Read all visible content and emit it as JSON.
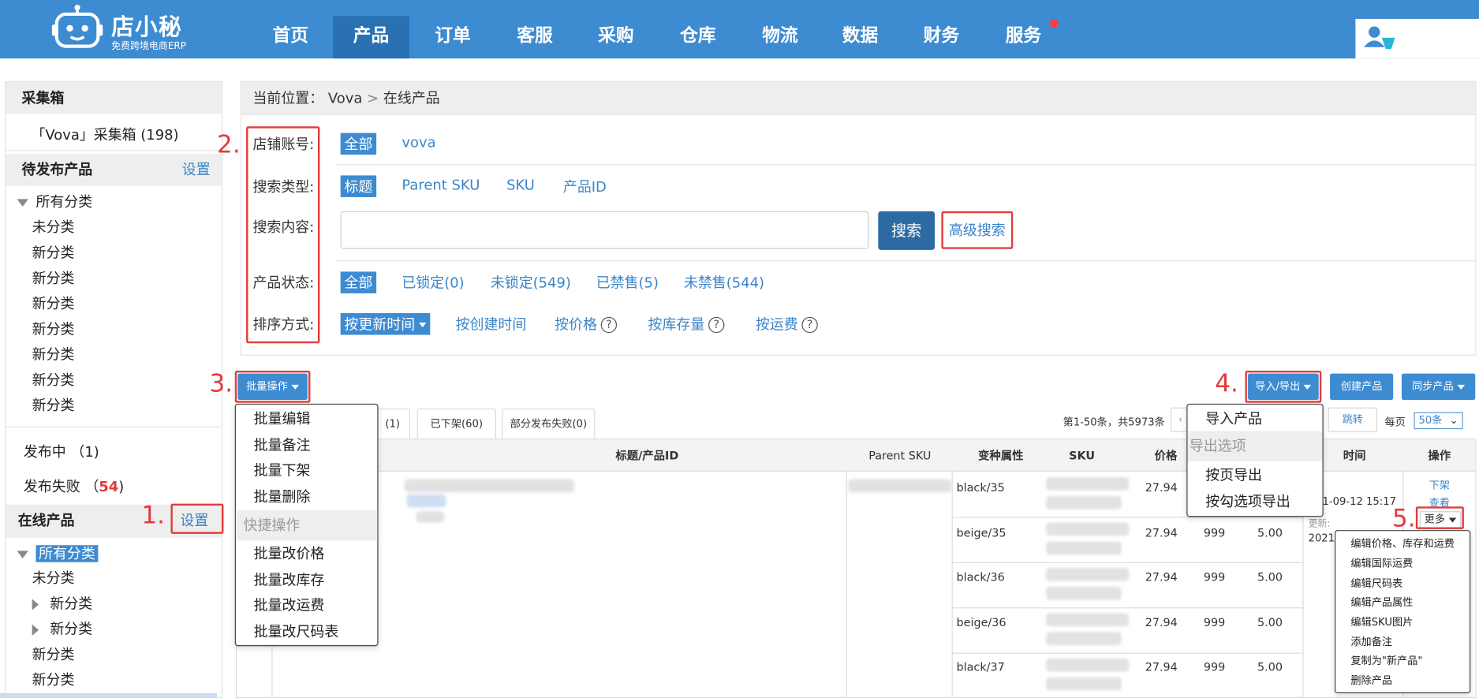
{
  "header": {
    "brand_name": "店小秘",
    "brand_tagline": "免费跨境电商ERP",
    "nav": [
      "首页",
      "产品",
      "订单",
      "客服",
      "采购",
      "仓库",
      "物流",
      "数据",
      "财务",
      "服务"
    ],
    "active_nav": "产品"
  },
  "sidebar": {
    "collect_box": {
      "title": "采集箱",
      "item": "「Vova」采集箱 (198)"
    },
    "pending": {
      "title": "待发布产品",
      "setting": "设置",
      "all": "所有分类",
      "items": [
        "未分类",
        "新分类",
        "新分类",
        "新分类",
        "新分类",
        "新分类",
        "新分类",
        "新分类"
      ]
    },
    "publishing": "发布中 （1)",
    "failed_label": "发布失败 （",
    "failed_count": "54",
    "failed_suffix": ")",
    "online": {
      "title": "在线产品",
      "setting": "设置",
      "all": "所有分类",
      "items": [
        "未分类",
        "新分类",
        "新分类",
        "新分类",
        "新分类"
      ]
    }
  },
  "breadcrumb": {
    "label": "当前位置：",
    "shop": "Vova",
    "sep": ">",
    "page": "在线产品"
  },
  "filters": {
    "shop_label": "店铺账号:",
    "shop_all": "全部",
    "shop_vova": "vova",
    "type_label": "搜索类型:",
    "types": [
      "标题",
      "Parent SKU",
      "SKU",
      "产品ID"
    ],
    "content_label": "搜索内容:",
    "search_btn": "搜索",
    "advanced": "高级搜索",
    "status_label": "产品状态:",
    "statuses": [
      "全部",
      "已锁定(0)",
      "未锁定(549)",
      "已禁售(5)",
      "未禁售(544)"
    ],
    "sort_label": "排序方式:",
    "sort_active": "按更新时间",
    "sorts": [
      "按创建时间",
      "按价格",
      "按库存量",
      "按运费"
    ],
    "help_glyph": "?"
  },
  "annotations": [
    "1.",
    "2.",
    "3.",
    "4.",
    "5."
  ],
  "toolbar": {
    "batch": "批量操作",
    "import_export": "导入/导出",
    "create": "创建产品",
    "sync": "同步产品"
  },
  "tabs": [
    "(1)",
    "已下架(60)",
    "部分发布失败(0)"
  ],
  "pagination": {
    "summary": "第1-50条，共5973条",
    "jump": "跳转",
    "per_page": "每页",
    "per_page_value": "50条"
  },
  "table": {
    "headers": [
      "标题/产品ID",
      "Parent SKU",
      "变种属性",
      "SKU",
      "价格",
      "时间",
      "操作"
    ],
    "rows": [
      {
        "variant": "black/35",
        "price": "27.94"
      },
      {
        "variant": "beige/35",
        "price": "27.94",
        "stock": "999",
        "shipping": "5.00"
      },
      {
        "variant": "black/36",
        "price": "27.94",
        "stock": "999",
        "shipping": "5.00"
      },
      {
        "variant": "beige/36",
        "price": "27.94",
        "stock": "999",
        "shipping": "5.00"
      },
      {
        "variant": "black/37",
        "price": "27.94",
        "stock": "999",
        "shipping": "5.00"
      }
    ],
    "time1_label": "建:",
    "time1_value": "1-09-12 15:17",
    "time2_label": "更新:",
    "time2_value": "2021-",
    "action_offshelf": "下架",
    "action_view": "查看",
    "action_more": "更多"
  },
  "batch_menu": {
    "items": [
      "批量编辑",
      "批量备注",
      "批量下架",
      "批量删除"
    ],
    "section": "快捷操作",
    "quick": [
      "批量改价格",
      "批量改库存",
      "批量改运费",
      "批量改尺码表"
    ]
  },
  "import_menu": {
    "import": "导入产品",
    "section": "导出选项",
    "exports": [
      "按页导出",
      "按勾选项导出"
    ]
  },
  "more_menu": [
    "编辑价格、库存和运费",
    "编辑国际运费",
    "编辑尺码表",
    "编辑产品属性",
    "编辑SKU图片",
    "添加备注",
    "复制为\"新产品\"",
    "删除产品"
  ],
  "colors": {
    "brand": "#3d8bd1",
    "nav_active": "#2a71b3",
    "annotation": "#e23b3b",
    "link": "#3a85c9"
  }
}
